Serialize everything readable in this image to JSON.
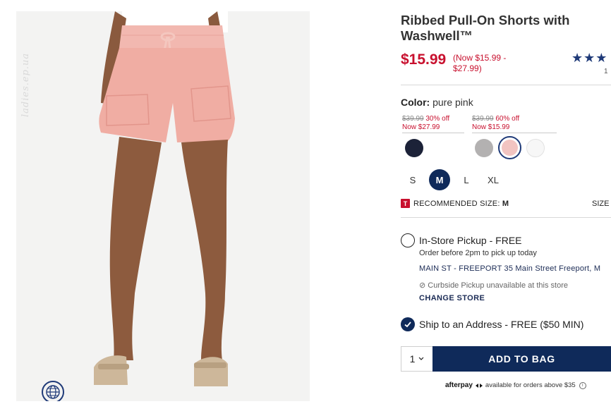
{
  "watermark": "ladies.ep.ua",
  "product": {
    "title_line1": "Ribbed Pull-On Shorts with",
    "title_line2": "Washwell™",
    "price": "$15.99",
    "price_range_line1": "(Now $15.99 -",
    "price_range_line2": "$27.99)",
    "stars": "★★★",
    "rating_count": "1"
  },
  "color": {
    "label": "Color:",
    "value": "pure pink",
    "deals": [
      {
        "was": "$39.99",
        "off": "30% off",
        "now": "Now $27.99"
      },
      {
        "was": "$39.99",
        "off": "60% off",
        "now": "Now $15.99"
      }
    ],
    "swatches": [
      {
        "name": "navy",
        "hex": "#1c2238"
      },
      {
        "name": "grey",
        "hex": "#b3b1b1"
      },
      {
        "name": "pure pink",
        "hex": "#f2c4c1",
        "selected": true
      },
      {
        "name": "white",
        "hex": "#f7f7f7"
      }
    ]
  },
  "sizes": [
    "S",
    "M",
    "L",
    "XL"
  ],
  "selected_size": "M",
  "recommendation": {
    "icon": "T",
    "label": "RECOMMENDED SIZE:",
    "value": "M",
    "size_guide": "SIZE"
  },
  "fulfillment": {
    "pickup_label": "In-Store Pickup - FREE",
    "pickup_sub": "Order before 2pm to pick up today",
    "store": "MAIN ST - FREEPORT 35 Main Street Freeport, M",
    "curbside": "Curbside Pickup unavailable at this store",
    "change_store": "CHANGE STORE",
    "ship_label": "Ship to an Address - FREE ($50 MIN)"
  },
  "cart": {
    "qty": "1",
    "add_label": "ADD TO BAG"
  },
  "afterpay": {
    "logo": "afterpay",
    "text": "available for orders above $35",
    "info": "i"
  },
  "colors": {
    "brand_navy": "#0f2a5a",
    "sale_red": "#c8102e"
  }
}
